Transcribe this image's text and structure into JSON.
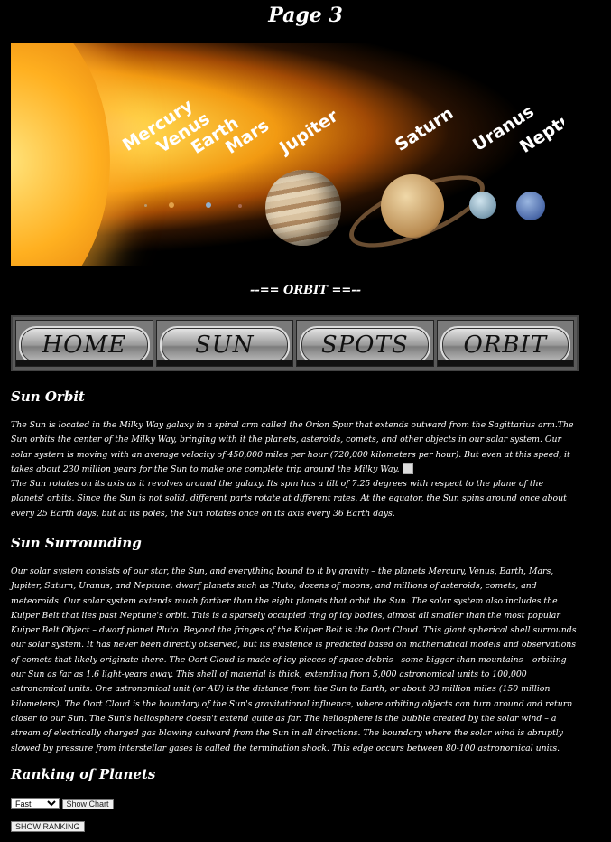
{
  "page_title": "Page 3",
  "hero": {
    "labels": {
      "mercury": "Mercury",
      "venus": "Venus",
      "earth": "Earth",
      "mars": "Mars",
      "jupiter": "Jupiter",
      "saturn": "Saturn",
      "uranus": "Uranus",
      "neptune": "Neptune"
    }
  },
  "subtitle": "--== ORBIT ==--",
  "nav": [
    "HOME",
    "SUN",
    "SPOTS",
    "ORBIT"
  ],
  "sections": {
    "orbit_heading": "Sun Orbit",
    "orbit_p1": "The Sun is located in the Milky Way galaxy in a spiral arm called the Orion Spur that extends outward from the Sagittarius arm.The Sun orbits the center of the Milky Way, bringing with it the planets, asteroids, comets, and other objects in our solar system. Our solar system is moving with an average velocity of 450,000 miles per hour (720,000 kilometers per hour). But even at this speed, it takes about 230 million years for the Sun to make one complete trip around the Milky Way.",
    "orbit_p2": "The Sun rotates on its axis as it revolves around the galaxy. Its spin has a tilt of 7.25 degrees with respect to the plane of the planets' orbits. Since the Sun is not solid, different parts rotate at different rates. At the equator, the Sun spins around once about every 25 Earth days, but at its poles, the Sun rotates once on its axis every 36 Earth days.",
    "surrounding_heading": "Sun Surrounding",
    "surrounding_p": "Our solar system consists of our star, the Sun, and everything bound to it by gravity – the planets Mercury, Venus, Earth, Mars, Jupiter, Saturn, Uranus, and Neptune; dwarf planets such as Pluto; dozens of moons; and millions of asteroids, comets, and meteoroids. Our solar system extends much farther than the eight planets that orbit the Sun. The solar system also includes the Kuiper Belt that lies past Neptune's orbit. This is a sparsely occupied ring of icy bodies, almost all smaller than the most popular Kuiper Belt Object – dwarf planet Pluto. Beyond the fringes of the Kuiper Belt is the Oort Cloud. This giant spherical shell surrounds our solar system. It has never been directly observed, but its existence is predicted based on mathematical models and observations of comets that likely originate there. The Oort Cloud is made of icy pieces of space debris - some bigger than mountains – orbiting our Sun as far as 1.6 light-years away. This shell of material is thick, extending from 5,000 astronomical units to 100,000 astronomical units. One astronomical unit (or AU) is the distance from the Sun to Earth, or about 93 million miles (150 million kilometers). The Oort Cloud is the boundary of the Sun's gravitational influence, where orbiting objects can turn around and return closer to our Sun. The Sun's heliosphere doesn't extend quite as far. The heliosphere is the bubble created by the solar wind – a stream of electrically charged gas blowing outward from the Sun in all directions. The boundary where the solar wind is abruptly slowed by pressure from interstellar gases is called the termination shock. This edge occurs between 80-100 astronomical units.",
    "ranking_heading": "Ranking of Planets"
  },
  "controls": {
    "select_value": "Fast",
    "show_chart": "Show Chart",
    "show_ranking": "SHOW RANKING"
  }
}
